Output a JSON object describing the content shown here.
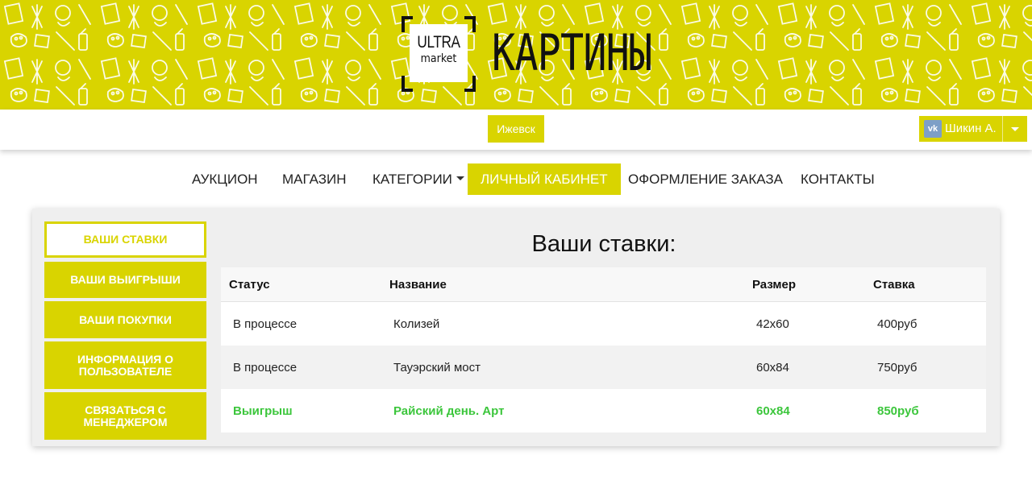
{
  "brand": {
    "logo_line1": "ULTRA",
    "logo_line2": "market",
    "site_title": "КАРТИНЫ",
    "banner_color": "#d9d400"
  },
  "topbar": {
    "city": "Ижевск",
    "user_name": "Шикин А.",
    "user_icon": "vk-icon"
  },
  "nav": {
    "items": [
      {
        "label": "АУКЦИОН"
      },
      {
        "label": "МАГАЗИН"
      },
      {
        "label": "КАТЕГОРИИ"
      },
      {
        "label": "ЛИЧНЫЙ КАБИНЕТ",
        "active": true
      },
      {
        "label": "ОФОРМЛЕНИЕ ЗАКАЗА"
      },
      {
        "label": "КОНТАКТЫ"
      }
    ]
  },
  "sidebar": {
    "items": [
      {
        "label": "ВАШИ СТАВКИ",
        "active": true
      },
      {
        "label": "ВАШИ ВЫИГРЫШИ"
      },
      {
        "label": "ВАШИ ПОКУПКИ"
      },
      {
        "label": "ИНФОРМАЦИЯ О ПОЛЬЗОВАТЕЛЕ"
      },
      {
        "label": "СВЯЗАТЬСЯ С МЕНЕДЖЕРОМ"
      }
    ]
  },
  "main": {
    "title": "Ваши ставки:",
    "table": {
      "columns": [
        "Статус",
        "Название",
        "Размер",
        "Ставка"
      ],
      "rows": [
        [
          "В процессе",
          "Колизей",
          "42x60",
          "400руб"
        ],
        [
          "В процессе",
          "Тауэрский мост",
          "60x84",
          "750руб"
        ],
        [
          "Выигрыш",
          "Райский день. Арт",
          "60x84",
          "850руб"
        ]
      ]
    },
    "win_color": "#3cc63c"
  }
}
